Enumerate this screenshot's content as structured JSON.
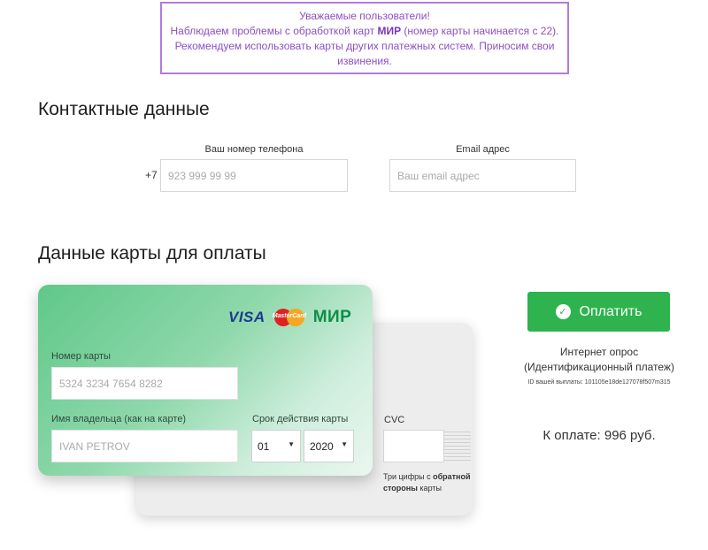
{
  "notice": {
    "line1": "Уважаемые пользователи!",
    "line2_pre": "Наблюдаем проблемы с обработкой карт ",
    "line2_bold": "МИР",
    "line2_post": " (номер карты начинается с 22).",
    "line3": "Рекомендуем использовать карты других платежных систем. Приносим свои",
    "line4": "извинения."
  },
  "contacts": {
    "title": "Контактные данные",
    "phone_label": "Ваш номер телефона",
    "phone_prefix": "+7",
    "phone_placeholder": "923 999 99 99",
    "email_label": "Email адрес",
    "email_placeholder": "Ваш email адрес"
  },
  "card": {
    "title": "Данные карты для оплаты",
    "logos": {
      "visa": "VISA",
      "mastercard": "MasterCard",
      "mir": "МИР"
    },
    "number_label": "Номер карты",
    "number_placeholder": "5324 3234 7654 8282",
    "holder_label": "Имя владельца (как на карте)",
    "holder_placeholder": "IVAN PETROV",
    "expiry_label": "Срок действия карты",
    "expiry_month": "01",
    "expiry_year": "2020",
    "cvc_label": "CVC",
    "cvc_hint_pre": "Три цифры с ",
    "cvc_hint_bold": "обратной стороны",
    "cvc_hint_post": " карты"
  },
  "payment": {
    "button_label": "Оплатить",
    "purpose_line1": "Интернет опрос",
    "purpose_line2": "(Идентификационный платеж)",
    "payment_id": "ID вашей выплаты: 101105e18de127078f507m315",
    "total": "К оплате: 996 руб."
  },
  "colors": {
    "accent_green": "#2eb34f",
    "notice_purple": "#b479dc"
  }
}
